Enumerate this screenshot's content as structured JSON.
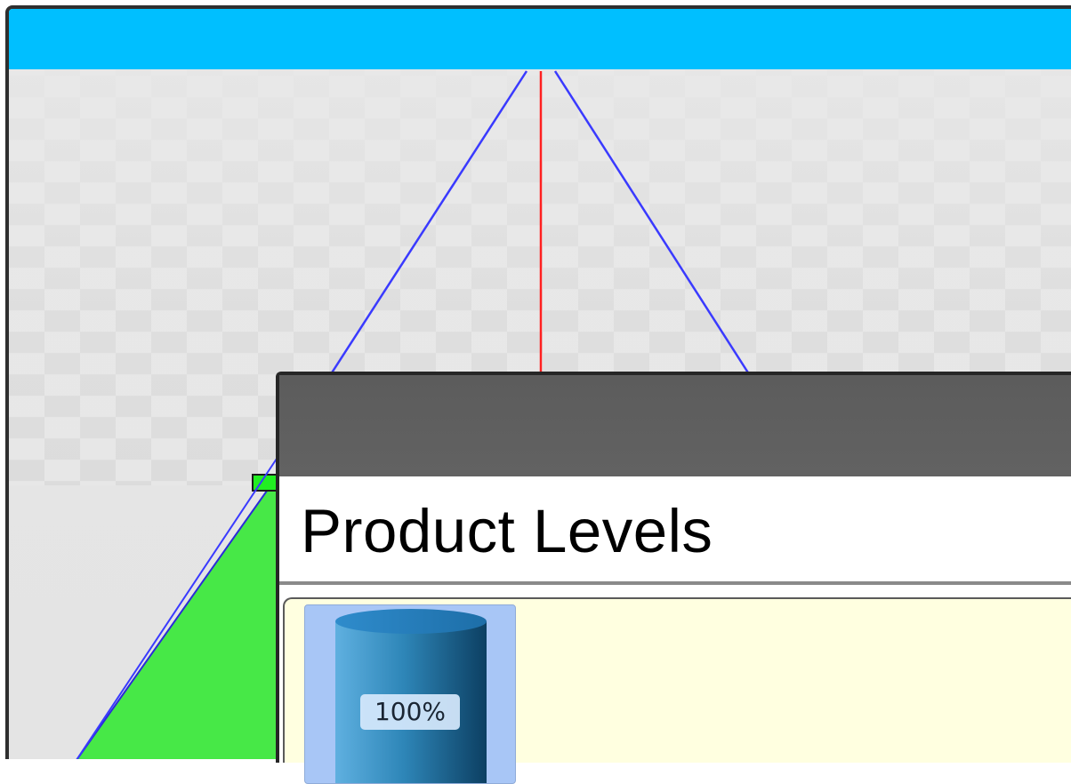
{
  "scene": {
    "sky_color": "#00bfff",
    "floor_colors": [
      "#e6e6e6",
      "#d8d8d8"
    ],
    "axis_line_colors": [
      "#3a3aff",
      "#ff2020"
    ],
    "selection_color": "#47e847"
  },
  "product_panel": {
    "title": "Product Levels",
    "titlebar_color": "#606060",
    "background_color": "#ffffe0",
    "tanks": [
      {
        "level_label": "100%",
        "level_fraction": 1.0,
        "icon": "cylinder-tank-icon"
      }
    ]
  }
}
